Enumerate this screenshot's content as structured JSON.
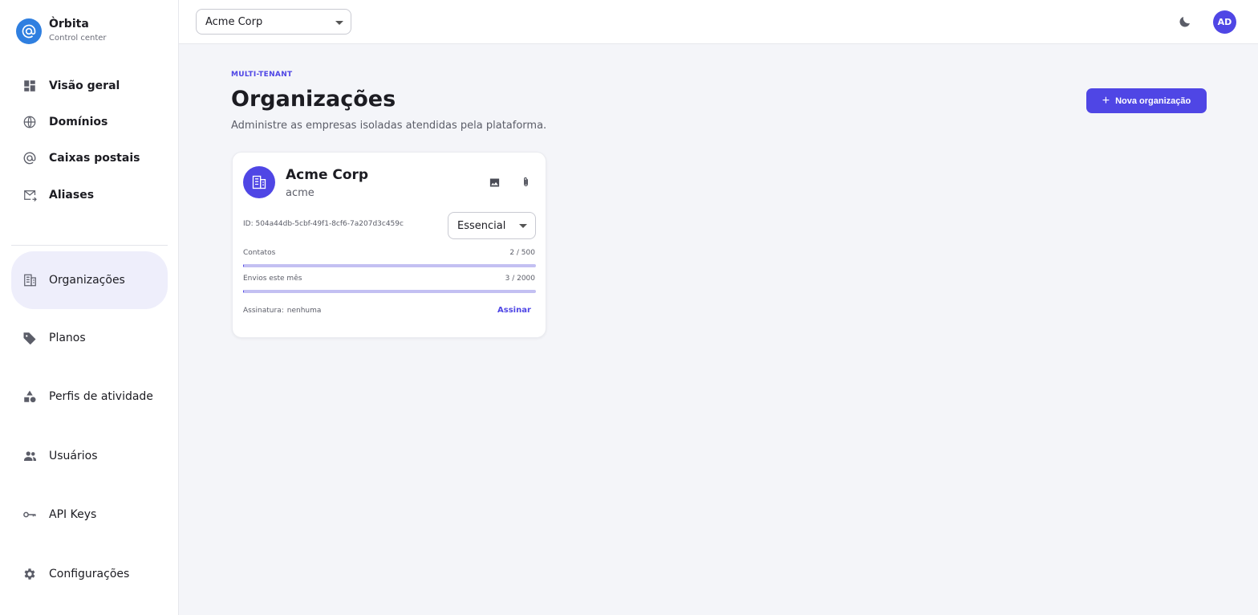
{
  "brand": {
    "name": "Òrbita",
    "subtitle": "Control center"
  },
  "sidebar": {
    "items": [
      {
        "label": "Visão geral",
        "icon": "dashboard-icon"
      },
      {
        "label": "Domínios",
        "icon": "globe-icon"
      },
      {
        "label": "Caixas postais",
        "icon": "at-sign-icon"
      },
      {
        "label": "Aliases",
        "icon": "mail-forward-icon"
      },
      {
        "label": "Organizações",
        "icon": "building-icon",
        "active": true
      },
      {
        "label": "Planos",
        "icon": "tag-icon"
      },
      {
        "label": "Perfis de atividade",
        "icon": "shapes-icon"
      },
      {
        "label": "Usuários",
        "icon": "people-icon"
      },
      {
        "label": "API Keys",
        "icon": "key-icon"
      },
      {
        "label": "Configurações",
        "icon": "gear-icon"
      }
    ]
  },
  "topbar": {
    "tenant": "Acme Corp",
    "theme_icon": "moon-icon",
    "avatar_initials": "AD"
  },
  "page": {
    "eyebrow": "MULTI-TENANT",
    "title": "Organizações",
    "subtitle": "Administre as empresas isoladas atendidas pela plataforma.",
    "new_button": "Nova organização"
  },
  "org_card": {
    "name": "Acme Corp",
    "slug": "acme",
    "id_text": "ID: 504a44db-5cbf-49f1-8cf6-7a207d3c459c",
    "plan": "Essencial",
    "contacts_label": "Contatos",
    "contacts_value": "2 / 500",
    "contacts_fraction": 0.004,
    "sends_label": "Envios este mês",
    "sends_value": "3 / 2000",
    "sends_fraction": 0.0015,
    "subscription_label": "Assinatura:",
    "subscription_value": "nenhuma",
    "subscribe_link": "Assinar"
  },
  "colors": {
    "accent": "#4f46e5",
    "brand_logo": "#2f7fe0"
  }
}
